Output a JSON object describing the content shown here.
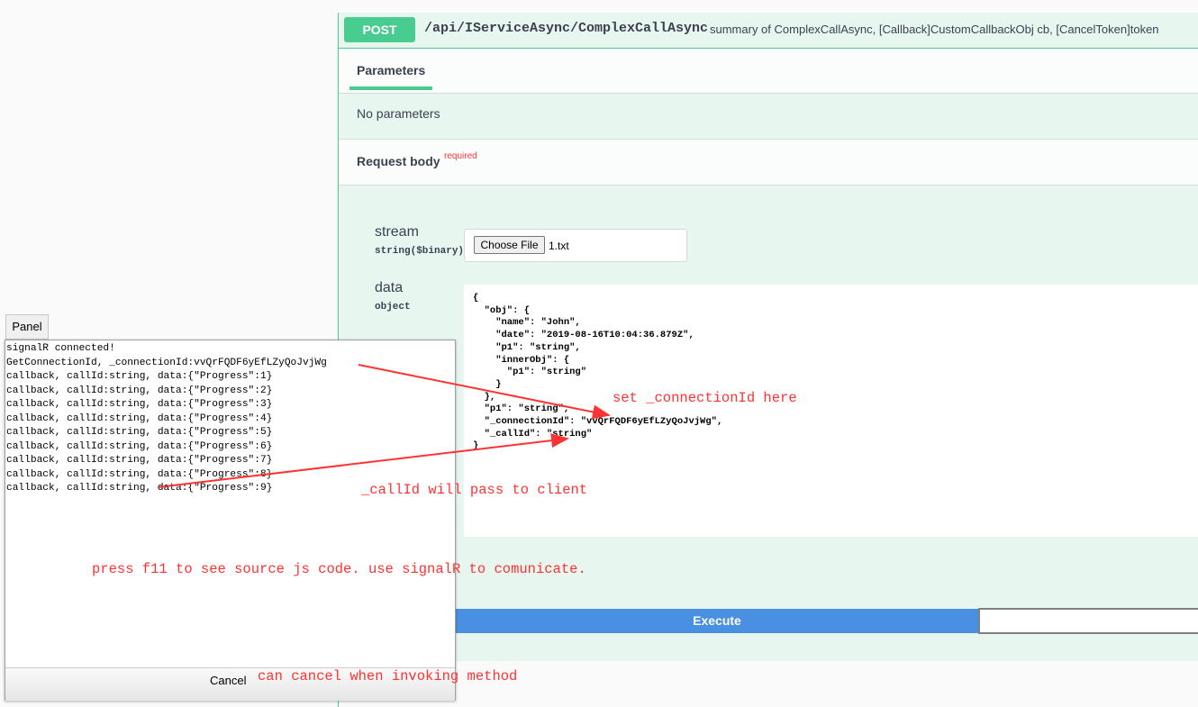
{
  "operation": {
    "method": "POST",
    "path": "/api/IServiceAsync/ComplexCallAsync",
    "summary": "summary of ComplexCallAsync, [Callback]CustomCallbackObj cb, [CancelToken]token"
  },
  "tabs": {
    "parameters": "Parameters"
  },
  "parameters": {
    "empty_text": "No parameters"
  },
  "request_body": {
    "label": "Request body",
    "required": "required",
    "fields": [
      {
        "name": "stream",
        "type": "string($binary)",
        "button": "Choose File",
        "file": "1.txt"
      },
      {
        "name": "data",
        "type": "object"
      }
    ],
    "json_value": "{\n  \"obj\": {\n    \"name\": \"John\",\n    \"date\": \"2019-08-16T10:04:36.879Z\",\n    \"p1\": \"string\",\n    \"innerObj\": {\n      \"p1\": \"string\"\n    }\n  },\n  \"p1\": \"string\",\n  \"_connectionId\": \"vvQrFQDF6yEfLZyQoJvjWg\",\n  \"_callId\": \"string\"\n}"
  },
  "execute_label": "Execute",
  "panel": {
    "toggle_label": "Panel",
    "log": [
      "signalR connected!",
      "GetConnectionId, _connectionId:vvQrFQDF6yEfLZyQoJvjWg",
      "callback, callId:string, data:{\"Progress\":1}",
      "callback, callId:string, data:{\"Progress\":2}",
      "callback, callId:string, data:{\"Progress\":3}",
      "callback, callId:string, data:{\"Progress\":4}",
      "callback, callId:string, data:{\"Progress\":5}",
      "callback, callId:string, data:{\"Progress\":6}",
      "callback, callId:string, data:{\"Progress\":7}",
      "callback, callId:string, data:{\"Progress\":8}",
      "callback, callId:string, data:{\"Progress\":9}"
    ],
    "cancel_label": "Cancel"
  },
  "annotations": {
    "connection": "set _connectionId here",
    "callid": "_callId will pass to client",
    "f11": "press f11 to see source js code. use signalR to comunicate.",
    "cancel": "can cancel when invoking method",
    "color": "#ff3333"
  }
}
